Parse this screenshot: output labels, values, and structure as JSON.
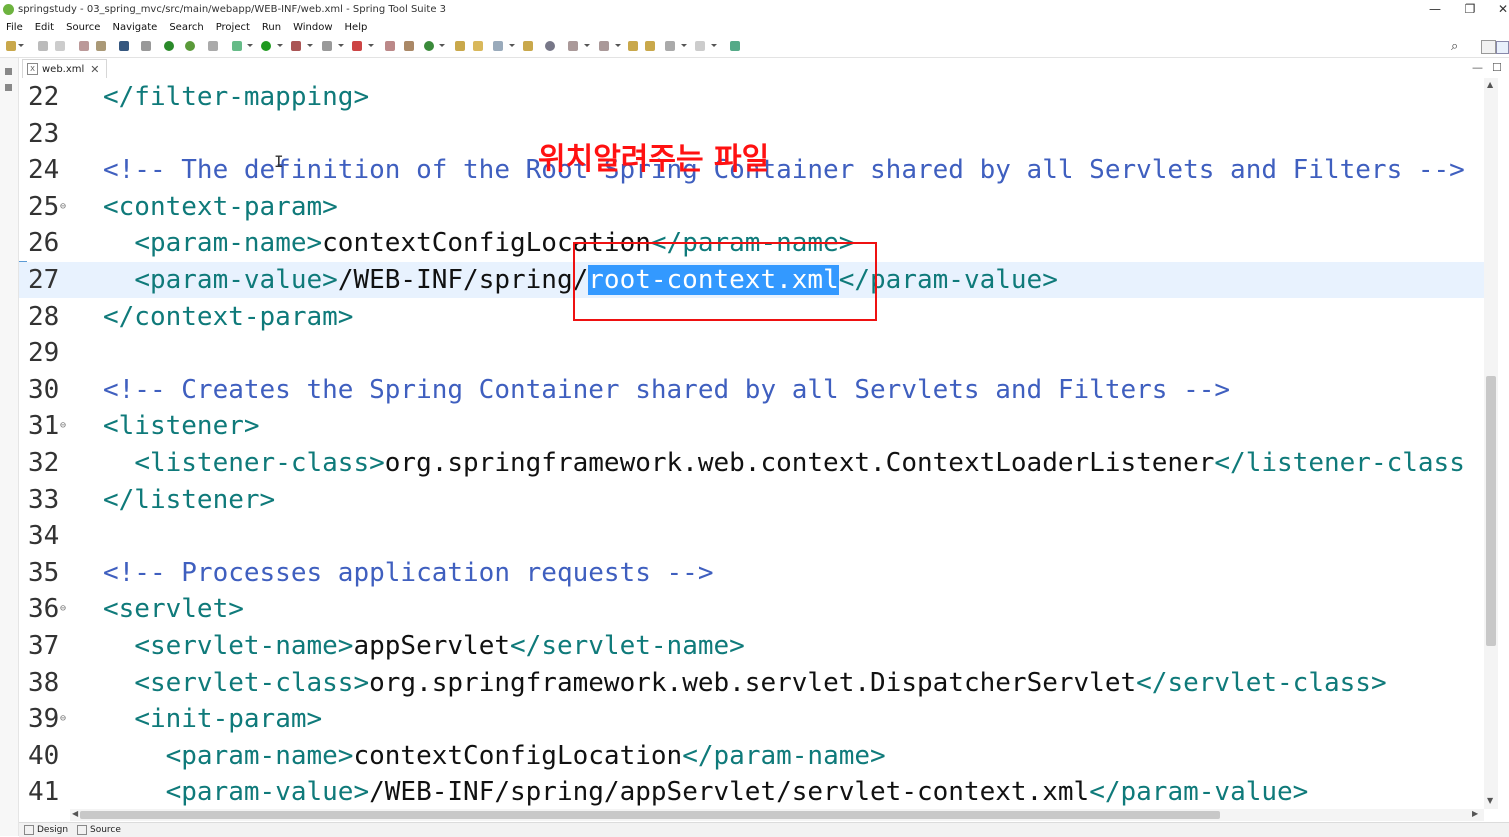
{
  "window": {
    "title": "springstudy - 03_spring_mvc/src/main/webapp/WEB-INF/web.xml - Spring Tool Suite 3",
    "minimize": "—",
    "restore": "❐",
    "close": "✕"
  },
  "menu": [
    "File",
    "Edit",
    "Source",
    "Navigate",
    "Search",
    "Project",
    "Run",
    "Window",
    "Help"
  ],
  "editor_tab": {
    "label": "web.xml",
    "close": "✕",
    "icon": "xml-file-icon"
  },
  "panel_controls": {
    "minimize": "—",
    "maximize": "☐"
  },
  "annotation": "위치알려주는 파일",
  "lines": [
    {
      "num": "22",
      "parts": [
        [
          "tag",
          "</filter-mapping>"
        ]
      ]
    },
    {
      "num": "23",
      "parts": []
    },
    {
      "num": "24",
      "parts": [
        [
          "cmt",
          "<!-- The definition of the Root Spring Container shared by all Servlets and Filters -->"
        ]
      ]
    },
    {
      "num": "25",
      "fold": "⊖",
      "parts": [
        [
          "tag",
          "<context-param>"
        ]
      ]
    },
    {
      "num": "26",
      "parts": [
        [
          "txt",
          "  "
        ],
        [
          "tag",
          "<param-name>"
        ],
        [
          "txt",
          "contextConfigLocation"
        ],
        [
          "tag",
          "</param-name>"
        ]
      ]
    },
    {
      "num": "27",
      "current": true,
      "parts": [
        [
          "txt",
          "  "
        ],
        [
          "tag",
          "<param-value>"
        ],
        [
          "txt",
          "/WEB-INF/spring/"
        ],
        [
          "sel",
          "root-context.xml"
        ],
        [
          "tag",
          "</param-value>"
        ]
      ]
    },
    {
      "num": "28",
      "parts": [
        [
          "tag",
          "</context-param>"
        ]
      ]
    },
    {
      "num": "29",
      "parts": []
    },
    {
      "num": "30",
      "parts": [
        [
          "cmt",
          "<!-- Creates the Spring Container shared by all Servlets and Filters -->"
        ]
      ]
    },
    {
      "num": "31",
      "fold": "⊖",
      "parts": [
        [
          "tag",
          "<listener>"
        ]
      ]
    },
    {
      "num": "32",
      "parts": [
        [
          "txt",
          "  "
        ],
        [
          "tag",
          "<listener-class>"
        ],
        [
          "txt",
          "org.springframework.web.context.ContextLoaderListener"
        ],
        [
          "tag",
          "</listener-class"
        ]
      ]
    },
    {
      "num": "33",
      "parts": [
        [
          "tag",
          "</listener>"
        ]
      ]
    },
    {
      "num": "34",
      "parts": []
    },
    {
      "num": "35",
      "parts": [
        [
          "cmt",
          "<!-- Processes application requests -->"
        ]
      ]
    },
    {
      "num": "36",
      "fold": "⊖",
      "parts": [
        [
          "tag",
          "<servlet>"
        ]
      ]
    },
    {
      "num": "37",
      "parts": [
        [
          "txt",
          "  "
        ],
        [
          "tag",
          "<servlet-name>"
        ],
        [
          "txt",
          "appServlet"
        ],
        [
          "tag",
          "</servlet-name>"
        ]
      ]
    },
    {
      "num": "38",
      "parts": [
        [
          "txt",
          "  "
        ],
        [
          "tag",
          "<servlet-class>"
        ],
        [
          "txt",
          "org.springframework.web.servlet.DispatcherServlet"
        ],
        [
          "tag",
          "</servlet-class>"
        ]
      ]
    },
    {
      "num": "39",
      "fold": "⊖",
      "parts": [
        [
          "txt",
          "  "
        ],
        [
          "tag",
          "<init-param>"
        ]
      ]
    },
    {
      "num": "40",
      "parts": [
        [
          "txt",
          "    "
        ],
        [
          "tag",
          "<param-name>"
        ],
        [
          "txt",
          "contextConfigLocation"
        ],
        [
          "tag",
          "</param-name>"
        ]
      ]
    },
    {
      "num": "41",
      "parts": [
        [
          "txt",
          "    "
        ],
        [
          "tag",
          "<param-value>"
        ],
        [
          "txt",
          "/WEB-INF/spring/appServlet/servlet-context.xml"
        ],
        [
          "tag",
          "</param-value>"
        ]
      ]
    }
  ],
  "bottom_tabs": [
    {
      "label": "Design",
      "icon": "design-icon"
    },
    {
      "label": "Source",
      "icon": "source-icon"
    }
  ],
  "colors": {
    "tag": "#0f7a7a",
    "comment": "#3f5fbf",
    "selection": "#3399ff",
    "current_line": "#e8f2fe",
    "annotation": "#ff1111"
  }
}
